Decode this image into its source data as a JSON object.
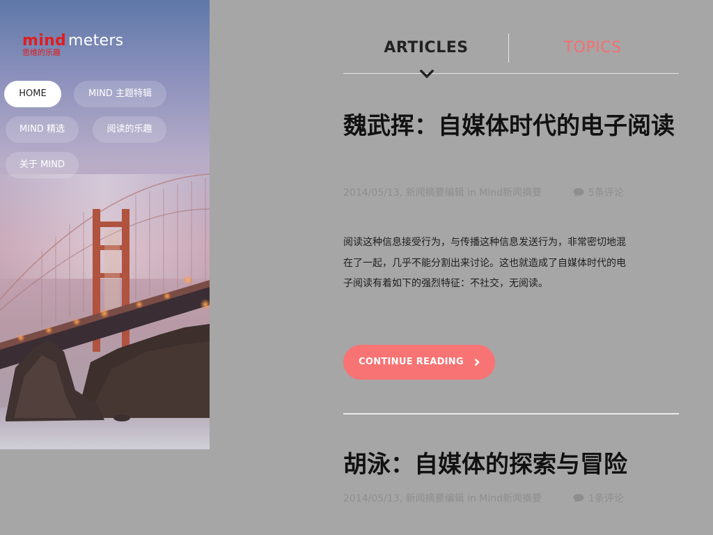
{
  "brand": {
    "logo_primary": "mind",
    "logo_secondary": "meters",
    "tagline": "思维的乐趣",
    "accent_color": "#e01d1d"
  },
  "nav": {
    "items": [
      {
        "label": "HOME",
        "active": true
      },
      {
        "label": "MIND 主题特辑",
        "active": false
      },
      {
        "label": "MIND 精选",
        "active": false
      },
      {
        "label": "阅读的乐趣",
        "active": false
      },
      {
        "label": "关于 MIND",
        "active": false
      }
    ]
  },
  "tabs": {
    "articles": "ARTICLES",
    "topics": "TOPICS",
    "active": "articles",
    "active_color": "#222222",
    "inactive_color": "#f56f6f"
  },
  "posts": [
    {
      "title": "魏武挥：自媒体时代的电子阅读",
      "date": "2014/05/13",
      "author": "新闻摘要编辑",
      "in_label": "in",
      "category": "Mind新闻摘要",
      "comments": "5条评论",
      "excerpt": "阅读这种信息接受行为，与传播这种信息发送行为，非常密切地混在了一起，几乎不能分割出来讨论。这也就造成了自媒体时代的电子阅读有着如下的强烈特征：不社交，无阅读。",
      "cta": "CONTINUE READING"
    },
    {
      "title": "胡泳：自媒体的探索与冒险",
      "date": "2014/05/13",
      "author": "新闻摘要编辑",
      "in_label": "in",
      "category": "Mind新闻摘要",
      "comments": "1条评论"
    }
  ],
  "icons": {
    "comment": "comment-icon",
    "caret": "chevron-down-icon",
    "cta_arrow": "chevron-right-icon"
  },
  "colors": {
    "background": "#a6a6a6",
    "cta": "#f87373"
  }
}
